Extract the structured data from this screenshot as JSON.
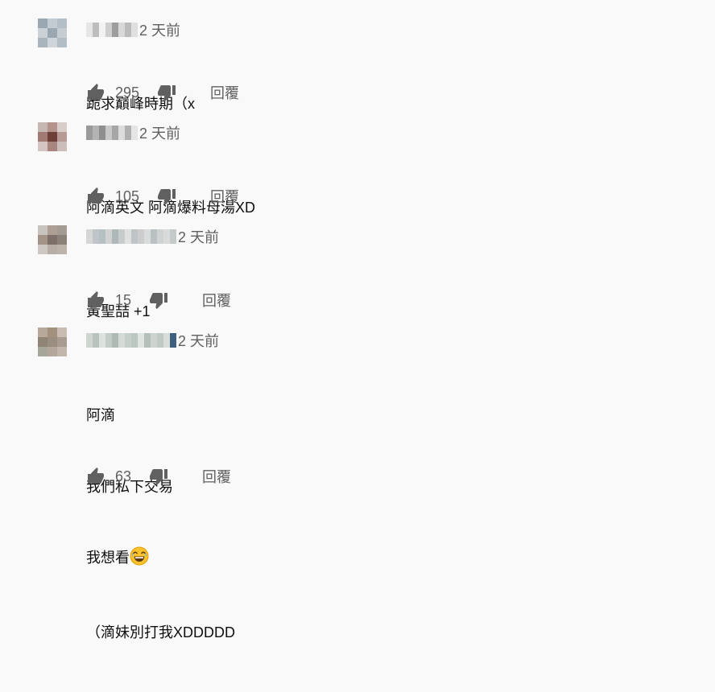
{
  "comments": [
    {
      "time": "2 天前",
      "lines": [
        "跪求巔峰時期（x"
      ],
      "likes": "295",
      "reply_label": "回覆",
      "avatar_colors": [
        "#9aa8b2",
        "#c3ccd3",
        "#b4bec6",
        "#cad2d8",
        "#9aa6b0",
        "#c5cdd3",
        "#a9b4bc",
        "#cfd6db",
        "#b2bcc4"
      ],
      "author_colors": [
        "#e6e6e6",
        "#bdbdbd",
        "#f2f2f2",
        "#cfcfcf",
        "#9e9e9e",
        "#d9d9d9",
        "#bcbcbc",
        "#e0e0e0"
      ]
    },
    {
      "time": "2 天前",
      "lines": [
        "阿滴英文 阿滴爆料母湯XD"
      ],
      "likes": "105",
      "reply_label": "回覆",
      "avatar_colors": [
        "#c7b7b3",
        "#b5938d",
        "#d8cdc9",
        "#a27a74",
        "#6e3f39",
        "#b79a95",
        "#d2c5c2",
        "#a98580",
        "#cbbdb9"
      ],
      "author_colors": [
        "#9a9a9a",
        "#b3b3b3",
        "#8f8f8f",
        "#c8c8c8",
        "#a6a6a6",
        "#dcdcdc",
        "#b0b0b0",
        "#e5e5e5"
      ]
    },
    {
      "time": "2 天前",
      "lines": [
        "黃聖喆 +1"
      ],
      "likes": "15",
      "reply_label": "回覆",
      "avatar_colors": [
        "#c9c3bd",
        "#ad9f93",
        "#a49c94",
        "#a39386",
        "#7c7069",
        "#8b8179",
        "#cfc8c2",
        "#b8aea6",
        "#bdb3ab"
      ],
      "author_colors": [
        "#d6d6d6",
        "#c0c6c8",
        "#b5c0c2",
        "#d2d2d2",
        "#aeb8b9",
        "#c7cbcc",
        "#e0e0e0",
        "#bfc5c6",
        "#cccccc",
        "#d8dcdc",
        "#b9c1c2",
        "#cfd3d3",
        "#dadada",
        "#c4c9ca"
      ]
    },
    {
      "time": "2 天前",
      "lines": [
        "阿滴",
        "我們私下交易",
        "我想看",
        "（滴妹別打我XDDDDD"
      ],
      "emoji_line": 2,
      "likes": "63",
      "reply_label": "回覆",
      "avatar_colors": [
        "#b8a89a",
        "#a4907f",
        "#c9bdb1",
        "#8f8475",
        "#9a8e80",
        "#a89b8f",
        "#a6a69a",
        "#b2a79a",
        "#c2b6aa"
      ],
      "author_colors": [
        "#cfd5d0",
        "#b8c3bc",
        "#dde2de",
        "#c3ccc6",
        "#aebbb3",
        "#d4dad6",
        "#c7cfca",
        "#bdc7c1",
        "#e1e5e2",
        "#b4bfb8",
        "#cdd4cf",
        "#c0c9c3",
        "#d8ddd9",
        "#3f5f7f"
      ]
    }
  ],
  "icons": {
    "like": "thumb-up-icon",
    "dislike": "thumb-down-icon",
    "emoji": "grinning-sweat-emoji"
  },
  "colors": {
    "background": "#f9f9f9",
    "text": "#0f0f0f",
    "muted": "#606060",
    "icon": "#606060"
  }
}
